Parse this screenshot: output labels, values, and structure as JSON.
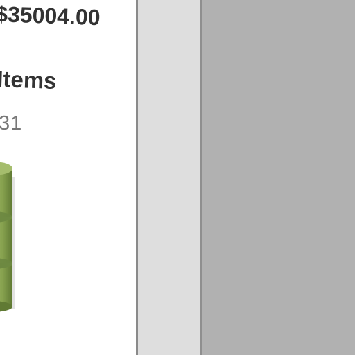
{
  "summary": {
    "price_text": "$35004.00",
    "items_heading": "Items",
    "items_count": "31"
  },
  "icons": {
    "stack": "stacked-cylinders-icon"
  },
  "colors": {
    "panel_background": "#ffffff",
    "text_dark": "#333333",
    "text_muted": "#777777",
    "stack_green": "#8ea65a",
    "divider_gray": "#dedede",
    "overlay_gray": "#b1b1b1"
  }
}
